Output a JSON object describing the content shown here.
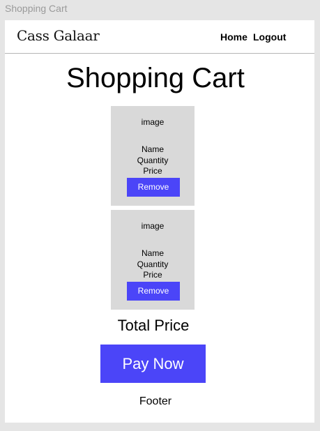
{
  "frame": {
    "label": "Shopping Cart"
  },
  "navbar": {
    "brand": "Cass Galaar",
    "links": [
      {
        "label": "Home"
      },
      {
        "label": "Logout"
      }
    ]
  },
  "main": {
    "title": "Shopping Cart",
    "items": [
      {
        "image": "image",
        "name": "Name",
        "quantity": "Quantity",
        "price": "Price",
        "remove_label": "Remove"
      },
      {
        "image": "image",
        "name": "Name",
        "quantity": "Quantity",
        "price": "Price",
        "remove_label": "Remove"
      }
    ],
    "total_label": "Total Price",
    "pay_label": "Pay Now"
  },
  "footer": {
    "text": "Footer"
  },
  "colors": {
    "accent": "#4b45f8",
    "card_bg": "#d9d9d9",
    "canvas_bg": "#e5e5e5"
  }
}
